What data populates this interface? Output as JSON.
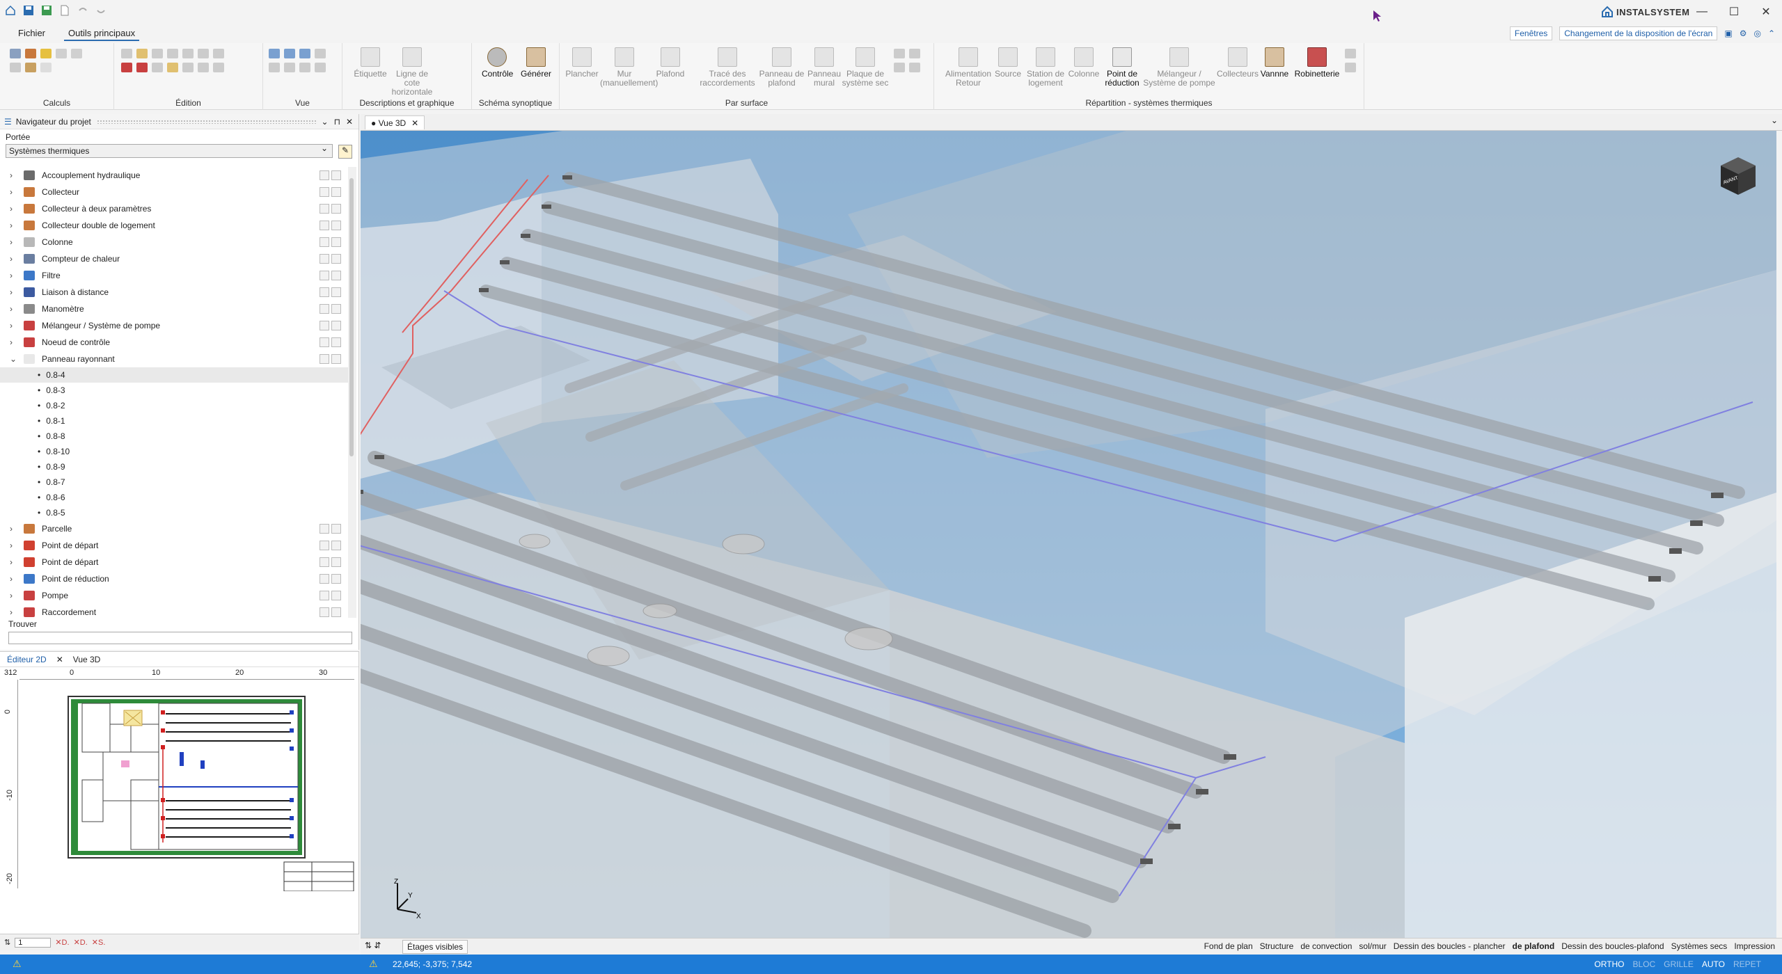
{
  "app": {
    "brand": "INSTALSYSTEM",
    "window_controls": [
      "—",
      "☐",
      "✕"
    ]
  },
  "menu": {
    "file": "Fichier",
    "main_tools": "Outils principaux",
    "windows": "Fenêtres",
    "layout_change": "Changement de la disposition de l'écran"
  },
  "ribbon": {
    "groups": {
      "calculs": "Calculs",
      "edition": "Édition",
      "vue": "Vue",
      "descriptions": "Descriptions et graphique",
      "schema": "Schéma synoptique",
      "par_surface": "Par surface",
      "repartition": "Répartition - systèmes thermiques"
    },
    "buttons": {
      "etiquette": "Étiquette",
      "ligne_cote": "Ligne de cote horizontale",
      "controle": "Contrôle",
      "generer": "Générer",
      "plancher": "Plancher",
      "mur_manuel": "Mur (manuellement)",
      "plafond": "Plafond",
      "trace": "Tracé des raccordements",
      "panneau_plafond": "Panneau de plafond",
      "panneau_mural": "Panneau mural",
      "plaque": "Plaque de système sec",
      "alim_retour": "Alimentation Retour",
      "source": "Source",
      "station": "Station de logement",
      "colonne": "Colonne",
      "point_reduction": "Point de réduction",
      "melangeur": "Mélangeur / Système de pompe",
      "collecteurs": "Collecteurs",
      "vanne": "Vannne",
      "robinetterie": "Robinetterie"
    }
  },
  "navigator": {
    "title": "Navigateur du projet",
    "scope_label": "Portée",
    "scope_value": "Systèmes thermiques",
    "find_label": "Trouver",
    "items_top": [
      {
        "label": "Accouplement hydraulique",
        "color": "#6b6b6b"
      },
      {
        "label": "Collecteur",
        "color": "#c8783c"
      },
      {
        "label": "Collecteur à deux paramètres",
        "color": "#c8783c"
      },
      {
        "label": "Collecteur double de logement",
        "color": "#c8783c"
      },
      {
        "label": "Colonne",
        "color": "#b8b8b8"
      },
      {
        "label": "Compteur de chaleur",
        "color": "#6a7ea0"
      },
      {
        "label": "Filtre",
        "color": "#3c78c8"
      },
      {
        "label": "Liaison à distance",
        "color": "#3c5aa0"
      },
      {
        "label": "Manomètre",
        "color": "#8a8a8a"
      },
      {
        "label": "Mélangeur / Système de pompe",
        "color": "#c84040"
      },
      {
        "label": "Noeud de contrôle",
        "color": "#c84040"
      },
      {
        "label": "Panneau rayonnant",
        "color": "#e8e8e8"
      }
    ],
    "children": [
      "0.8-4",
      "0.8-3",
      "0.8-2",
      "0.8-1",
      "0.8-8",
      "0.8-10",
      "0.8-9",
      "0.8-7",
      "0.8-6",
      "0.8-5"
    ],
    "items_bottom": [
      {
        "label": "Parcelle",
        "color": "#c8783c"
      },
      {
        "label": "Point de départ",
        "color": "#d04030"
      },
      {
        "label": "Point de départ",
        "color": "#d04030"
      },
      {
        "label": "Point de réduction",
        "color": "#3c78c8"
      },
      {
        "label": "Pompe",
        "color": "#c84040"
      },
      {
        "label": "Raccordement",
        "color": "#c84040"
      }
    ]
  },
  "editor2d": {
    "tab_active": "Éditeur 2D",
    "tab_other": "Vue 3D",
    "ruler_h": [
      "0",
      "10",
      "20",
      "30"
    ],
    "ruler_v": [
      "312",
      "0",
      "-10",
      "-20"
    ],
    "bottom_value": "1"
  },
  "view3d": {
    "tab": "● Vue 3D",
    "cube_label": "AVANT"
  },
  "layerbar": {
    "visible_floors": "Étages visibles",
    "layers": [
      "Fond de plan",
      "Structure",
      "de convection",
      "sol/mur",
      "Dessin des boucles - plancher",
      "de plafond",
      "Dessin des boucles-plafond",
      "Systèmes secs",
      "Impression"
    ]
  },
  "status": {
    "coords": "22,645; -3,375; 7,542",
    "modes": [
      "ORTHO",
      "BLOC",
      "GRILLE",
      "AUTO",
      "REPET"
    ]
  }
}
